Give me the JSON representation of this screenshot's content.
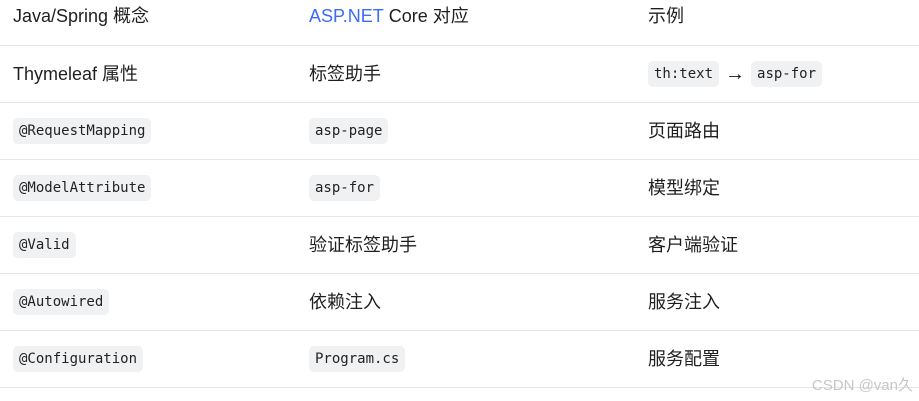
{
  "header": {
    "col1": "Java/Spring 概念",
    "col2_accent": "ASP.NET",
    "col2_rest": " Core 对应",
    "col3": "示例"
  },
  "rows": [
    {
      "col1_text": "Thymeleaf 属性",
      "col2_text": "标签助手",
      "col3_code_a": "th:text",
      "col3_arrow": "→",
      "col3_code_b": "asp-for"
    },
    {
      "col1_code": "@RequestMapping",
      "col2_code": "asp-page",
      "col3_text": "页面路由"
    },
    {
      "col1_code": "@ModelAttribute",
      "col2_code": "asp-for",
      "col3_text": "模型绑定"
    },
    {
      "col1_code": "@Valid",
      "col2_text": "验证标签助手",
      "col3_text": "客户端验证"
    },
    {
      "col1_code": "@Autowired",
      "col2_text": "依赖注入",
      "col3_text": "服务注入"
    },
    {
      "col1_code": "@Configuration",
      "col2_code": "Program.cs",
      "col3_text": "服务配置"
    }
  ],
  "watermark": "CSDN @van久",
  "colors": {
    "accent": "#3b6cf6",
    "code_bg": "#f0f1f3",
    "divider": "#e6e6e6"
  }
}
